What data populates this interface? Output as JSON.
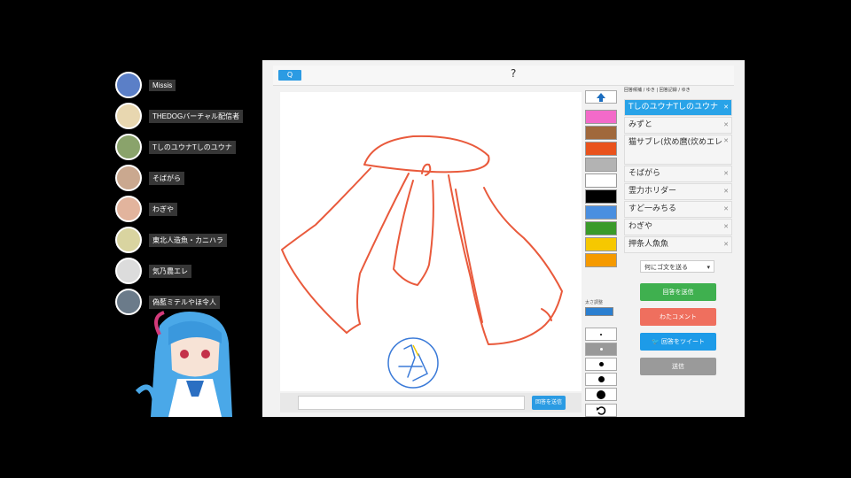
{
  "players": [
    {
      "name": "Missis",
      "color": "#5b7fc7"
    },
    {
      "name": "THEDOGバーチャル配信者",
      "color": "#e8d7b0"
    },
    {
      "name": "TしのユウナTしのユウナ",
      "color": "#8aa36b"
    },
    {
      "name": "そばがら",
      "color": "#caa88f"
    },
    {
      "name": "わぎや",
      "color": "#e2b49d"
    },
    {
      "name": "東北人造魚・カニハラ",
      "color": "#d9d4a0"
    },
    {
      "name": "気乃農エレ",
      "color": "#dcdcdc"
    },
    {
      "name": "偽藍ミテルやほ令人",
      "color": "#6b7b8a"
    }
  ],
  "topbar": {
    "button_label": "Q",
    "hint": "?"
  },
  "chat": {
    "placeholder": "",
    "send_label": "回答を送信"
  },
  "palette": {
    "colors": [
      "#f36ac9",
      "#a0683c",
      "#e9521c",
      "#b3b3b3",
      "#ffffff",
      "#000000",
      "#4a8fe0",
      "#3a9a2a",
      "#f6c800",
      "#f59a00"
    ],
    "size_label": "太さ調整",
    "undo_icon": "undo-icon",
    "up_icon": "up-arrow-icon"
  },
  "answers": {
    "title": "回答候補 / ゆき  |  回答記録 / ゆき",
    "items": [
      {
        "text": "TしのユウナTしのユウナ",
        "selected": true
      },
      {
        "text": "みずと",
        "selected": false
      },
      {
        "text": "猫サブレ(炊め麿(炊めエレ",
        "selected": false
      },
      {
        "text": "そばがら",
        "selected": false
      },
      {
        "text": "霊力ホリダー",
        "selected": false
      },
      {
        "text": "すど一みちる",
        "selected": false
      },
      {
        "text": "わぎや",
        "selected": false
      },
      {
        "text": "押条人魚魚",
        "selected": false
      }
    ],
    "dropdown": "何にゴ文を送る",
    "buttons": [
      {
        "label": "回答を送信",
        "color": "#3fb04f"
      },
      {
        "label": "わたコメント",
        "color": "#ef6f5e"
      },
      {
        "label": "回答をツイート",
        "color": "#1d9be8"
      },
      {
        "label": "送信",
        "color": "#9a9a9a"
      }
    ]
  }
}
